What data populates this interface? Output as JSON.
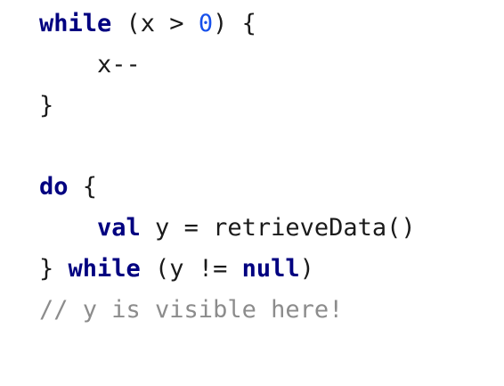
{
  "code": {
    "line1": {
      "kw_while": "while",
      "open": " (x > ",
      "zero": "0",
      "close": ") {"
    },
    "line2": {
      "text": "x--"
    },
    "line3": {
      "text": "}"
    },
    "line5": {
      "kw_do": "do",
      "rest": " {"
    },
    "line6": {
      "kw_val": "val",
      "rest": " y = retrieveData()"
    },
    "line7": {
      "brace": "} ",
      "kw_while": "while",
      "middle": " (y != ",
      "kw_null": "null",
      "close": ")"
    },
    "line8": {
      "comment": "// y is visible here!"
    }
  }
}
